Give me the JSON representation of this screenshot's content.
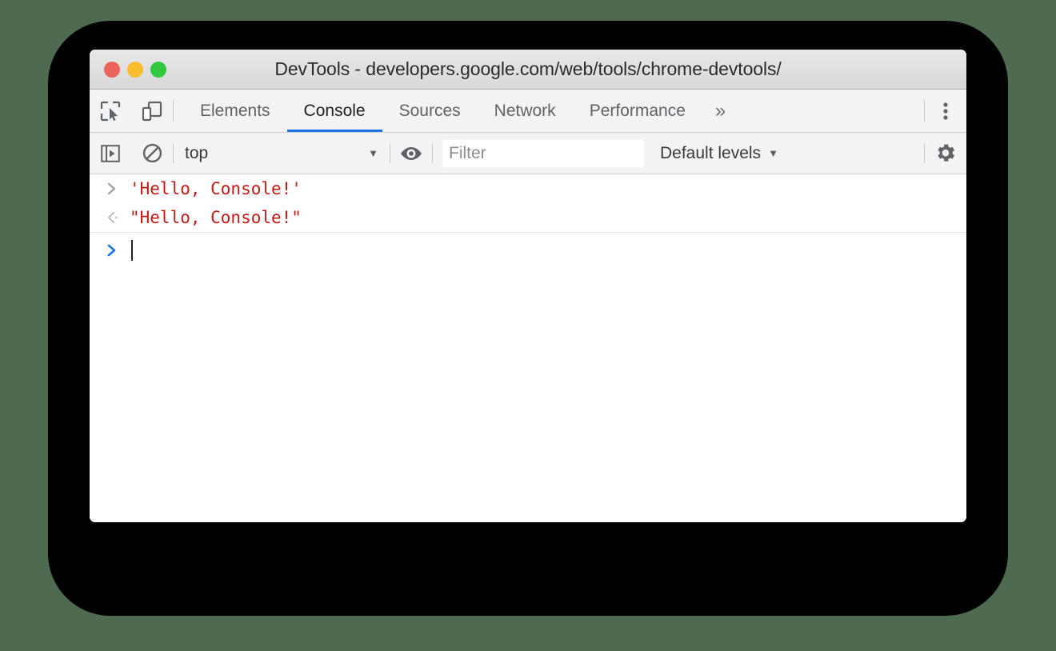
{
  "window": {
    "title": "DevTools - developers.google.com/web/tools/chrome-devtools/",
    "controls": [
      {
        "name": "close-button",
        "color": "#ec6459"
      },
      {
        "name": "minimize-button",
        "color": "#f7bd2e"
      },
      {
        "name": "maximize-button",
        "color": "#2fc840"
      }
    ]
  },
  "toolbar_left": {
    "inspect_icon": "inspect-element-icon",
    "device_icon": "device-toolbar-icon"
  },
  "tabs": [
    {
      "label": "Elements",
      "active": false
    },
    {
      "label": "Console",
      "active": true
    },
    {
      "label": "Sources",
      "active": false
    },
    {
      "label": "Network",
      "active": false
    },
    {
      "label": "Performance",
      "active": false
    }
  ],
  "tabs_overflow_label": "»",
  "main_menu_icon": "kebab-menu-icon",
  "console_toolbar": {
    "sidebar_toggle_icon": "console-sidebar-toggle-icon",
    "clear_icon": "clear-console-icon",
    "context": {
      "value": "top",
      "caret": "▼"
    },
    "eye_icon": "live-expression-eye-icon",
    "filter": {
      "value": "",
      "placeholder": "Filter"
    },
    "levels": {
      "value": "Default levels",
      "caret": "▼"
    },
    "settings_icon": "gear-icon"
  },
  "console_messages": [
    {
      "kind": "input",
      "gutter_icon": "input-chevron-icon",
      "text": "'Hello, Console!'",
      "color": "#c41a16"
    },
    {
      "kind": "output",
      "gutter_icon": "output-return-arrow-icon",
      "text": "\"Hello, Console!\"",
      "color": "#c41a16"
    }
  ],
  "prompt": {
    "gutter_icon": "prompt-chevron-icon",
    "value": "",
    "caret_color": "#202124",
    "chevron_color": "#1a73e8"
  },
  "colors": {
    "backdrop": "#4e6b52",
    "shadow_plate": "#000000",
    "window_bg": "#ffffff",
    "toolbar_bg": "#f3f3f3",
    "active_tab_underline": "#1a73e8",
    "string_red": "#c41a16",
    "icon_gray": "#5f6368"
  }
}
